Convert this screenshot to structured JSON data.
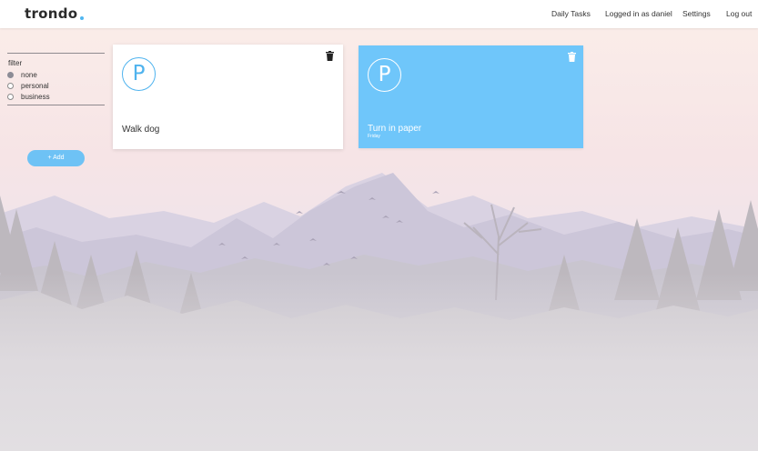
{
  "app": {
    "brand": "trondo"
  },
  "nav": {
    "items": [
      "Daily Tasks",
      "Logged in as daniel",
      "Settings",
      "Log out"
    ]
  },
  "filter": {
    "title": "filter",
    "options": [
      {
        "label": "none",
        "checked": true
      },
      {
        "label": "personal",
        "checked": false
      },
      {
        "label": "business",
        "checked": false
      }
    ]
  },
  "add_button": {
    "label": "+ Add"
  },
  "cards": [
    {
      "avatar": "P",
      "title": "Walk dog",
      "subtitle": "",
      "style": "white"
    },
    {
      "avatar": "P",
      "title": "Turn in paper",
      "subtitle": "Friday",
      "style": "blue"
    }
  ],
  "colors": {
    "accent": "#6ec2f5",
    "card_blue": "#6fc6fa",
    "text_dark": "#333333"
  }
}
